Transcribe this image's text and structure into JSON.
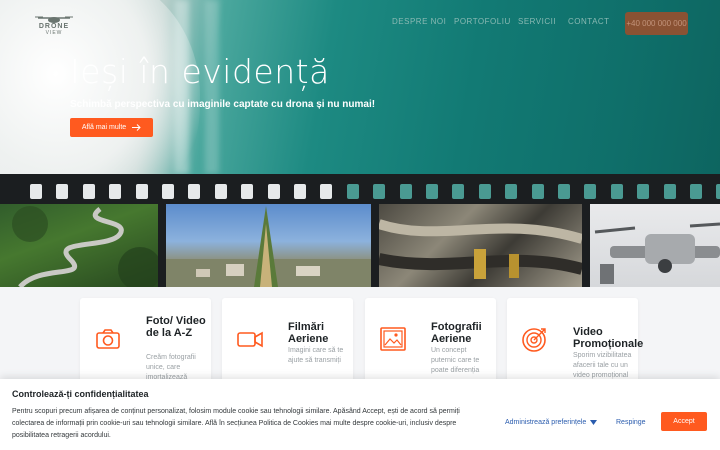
{
  "header": {
    "logo_line1": "DRONE",
    "logo_line2": "VIEW",
    "nav": [
      "DESPRE NOI",
      "PORTOFOLIU",
      "SERVICII",
      "CONTACT"
    ],
    "phone": "+40 000 000 000"
  },
  "hero": {
    "title": "Ieși în evidență",
    "subtitle": "Schimbă perspectiva cu imaginile captate cu drona și nu numai!",
    "button": "Află mai multe"
  },
  "services": [
    {
      "title": "Foto/ Video de la A-Z",
      "desc": "Creăm fotografii unice, care imortalizează",
      "icon": "camera-icon"
    },
    {
      "title": "Filmări Aeriene",
      "desc": "Imagini care să te ajute să transmiți",
      "icon": "video-camera-icon"
    },
    {
      "title": "Fotografii Aeriene",
      "desc": "Un concept puternic care te poate diferenția",
      "icon": "image-icon"
    },
    {
      "title": "Video Promoționale",
      "desc": "Sporim vizibilitatea afacerii tale cu un video promoțional",
      "icon": "target-icon"
    }
  ],
  "cookie": {
    "title": "Controlează-ți confidențialitatea",
    "text": "Pentru scopuri precum afișarea de conținut personalizat, folosim module cookie sau tehnologii similare. Apăsând Accept, ești de acord să permiți colectarea de informații prin cookie-uri sau tehnologii similare. Află în secțiunea Politica de Cookies mai multe despre cookie-uri, inclusiv despre posibilitatea retragerii acordului.",
    "preferences": "Administrează preferințele",
    "reject": "Respinge",
    "accept": "Accept"
  },
  "colors": {
    "accent": "#ff5a1f",
    "link": "#2a5cae"
  }
}
